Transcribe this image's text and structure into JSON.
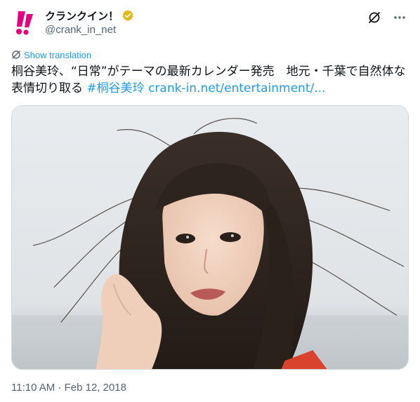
{
  "account": {
    "display_name": "クランクイン！",
    "handle": "@crank_in_net",
    "verified": true,
    "verified_color": "#e2b719",
    "brand_color": "#e6007e"
  },
  "actions": {
    "grok_icon": "grok-icon",
    "more_icon": "more-icon"
  },
  "translation": {
    "label": "Show translation"
  },
  "tweet": {
    "text_main": "桐谷美玲、“日常”がテーマの最新カレンダー発売　地元・千葉で自然体な表情切り取る ",
    "hashtag": "#桐谷美玲",
    "link": "crank-in.net/entertainment/..."
  },
  "media": {
    "kind": "photo",
    "subject": "portrait"
  },
  "meta": {
    "timestamp": "11:10 AM · Feb 12, 2018"
  }
}
